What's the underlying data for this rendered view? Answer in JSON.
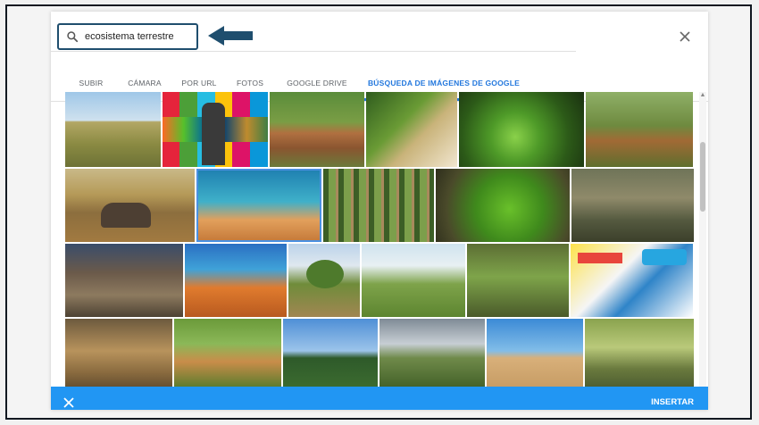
{
  "search": {
    "query": "ecosistema terrestre"
  },
  "tabs": [
    {
      "label": "SUBIR"
    },
    {
      "label": "CÁMARA"
    },
    {
      "label": "POR URL"
    },
    {
      "label": "FOTOS"
    },
    {
      "label": "GOOGLE DRIVE"
    },
    {
      "label": "BÚSQUEDA DE IMÁGENES DE GOOGLE"
    }
  ],
  "active_tab": "BÚSQUEDA DE IMÁGENES DE GOOGLE",
  "footer": {
    "insert_label": "INSERTAR"
  },
  "icons": {
    "search": "search-icon",
    "close": "close-icon",
    "arrow": "arrow-left-icon"
  },
  "colors": {
    "accent": "#2196f3",
    "tab_active": "#2277dd",
    "annotation_border": "#1f4e6e"
  },
  "images": {
    "rows": [
      [
        {
          "subject": "grassland savanna"
        },
        {
          "subject": "sustainable development goals poster"
        },
        {
          "subject": "tortoises on ground"
        },
        {
          "subject": "green leaves and insect"
        },
        {
          "subject": "mossy forest floor"
        },
        {
          "subject": "lizard in forest"
        }
      ],
      [
        {
          "subject": "elephants in savanna"
        },
        {
          "subject": "coral reef with fish"
        },
        {
          "subject": "pine forest"
        },
        {
          "subject": "green moss on ground"
        },
        {
          "subject": "toad on leaves"
        }
      ],
      [
        {
          "subject": "coral reef"
        },
        {
          "subject": "coral reef with orange fish"
        },
        {
          "subject": "big tree in field"
        },
        {
          "subject": "green meadow with tree"
        },
        {
          "subject": "moss and plants"
        },
        {
          "subject": "ecosystem illustration"
        }
      ],
      [
        {
          "subject": "camouflaged bird"
        },
        {
          "subject": "deer in forest"
        },
        {
          "subject": "forest with mountains"
        },
        {
          "subject": "cloudy hills with trees"
        },
        {
          "subject": "sand dunes"
        },
        {
          "subject": "turtles in pond"
        }
      ]
    ]
  }
}
